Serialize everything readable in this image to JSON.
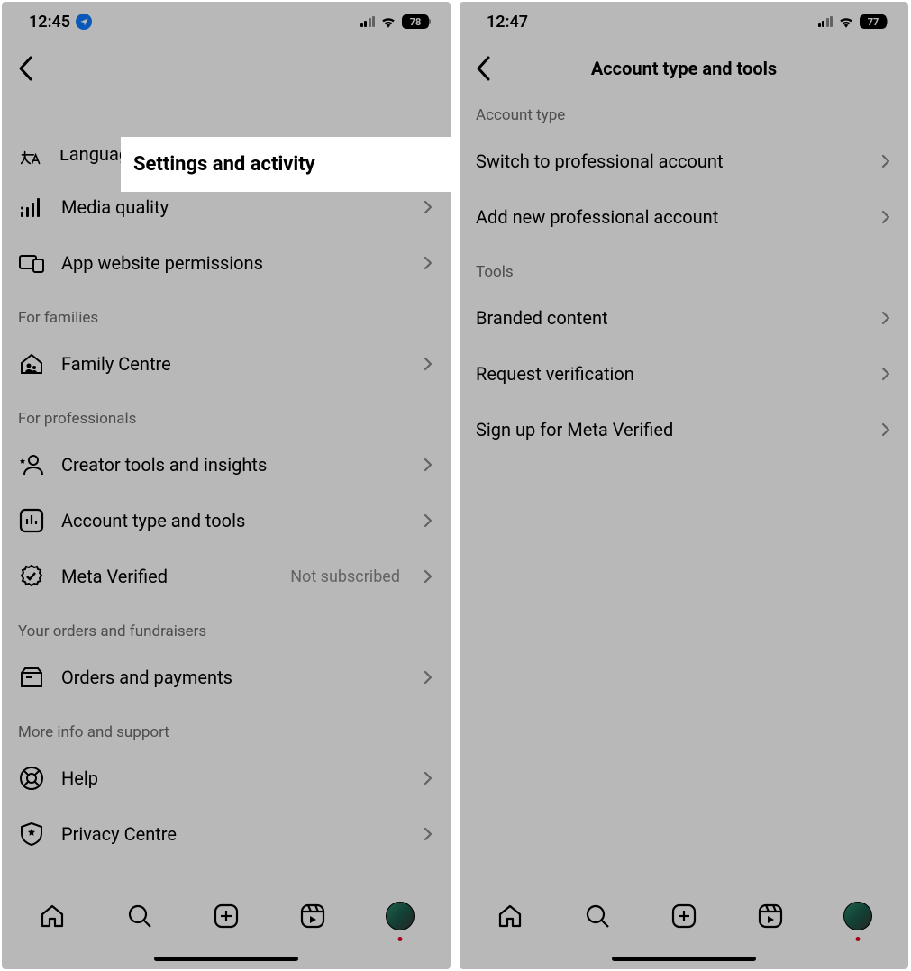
{
  "left_screen": {
    "status": {
      "time": "12:45",
      "battery": "78"
    },
    "title": "Settings and activity",
    "partial_row": {
      "label": "Language"
    },
    "rows_top": [
      {
        "label": "Media quality"
      },
      {
        "label": "App website permissions"
      }
    ],
    "section_families": "For families",
    "rows_families": [
      {
        "label": "Family Centre"
      }
    ],
    "section_professionals": "For professionals",
    "rows_professionals": [
      {
        "label": "Creator tools and insights"
      },
      {
        "label": "Account type and tools",
        "highlight": true
      },
      {
        "label": "Meta Verified",
        "secondary": "Not subscribed"
      }
    ],
    "section_orders": "Your orders and fundraisers",
    "rows_orders": [
      {
        "label": "Orders and payments"
      }
    ],
    "section_support": "More info and support",
    "rows_support": [
      {
        "label": "Help"
      },
      {
        "label": "Privacy Centre"
      }
    ]
  },
  "right_screen": {
    "status": {
      "time": "12:47",
      "battery": "77"
    },
    "title": "Account type and tools",
    "section_account_type": "Account type",
    "rows_account_type": [
      {
        "label": "Switch to professional account",
        "highlight": true
      },
      {
        "label": "Add new professional account"
      }
    ],
    "section_tools": "Tools",
    "rows_tools": [
      {
        "label": "Branded content"
      },
      {
        "label": "Request verification"
      },
      {
        "label": "Sign up for Meta Verified"
      }
    ]
  },
  "icons": {
    "language": "language-icon",
    "media_quality": "signal-bars-icon",
    "app_website": "devices-icon",
    "family_centre": "house-people-icon",
    "creator_tools": "star-person-icon",
    "account_type": "chart-square-icon",
    "meta_verified": "badge-check-icon",
    "orders": "box-icon",
    "help": "lifebuoy-icon",
    "privacy": "shield-star-icon"
  }
}
